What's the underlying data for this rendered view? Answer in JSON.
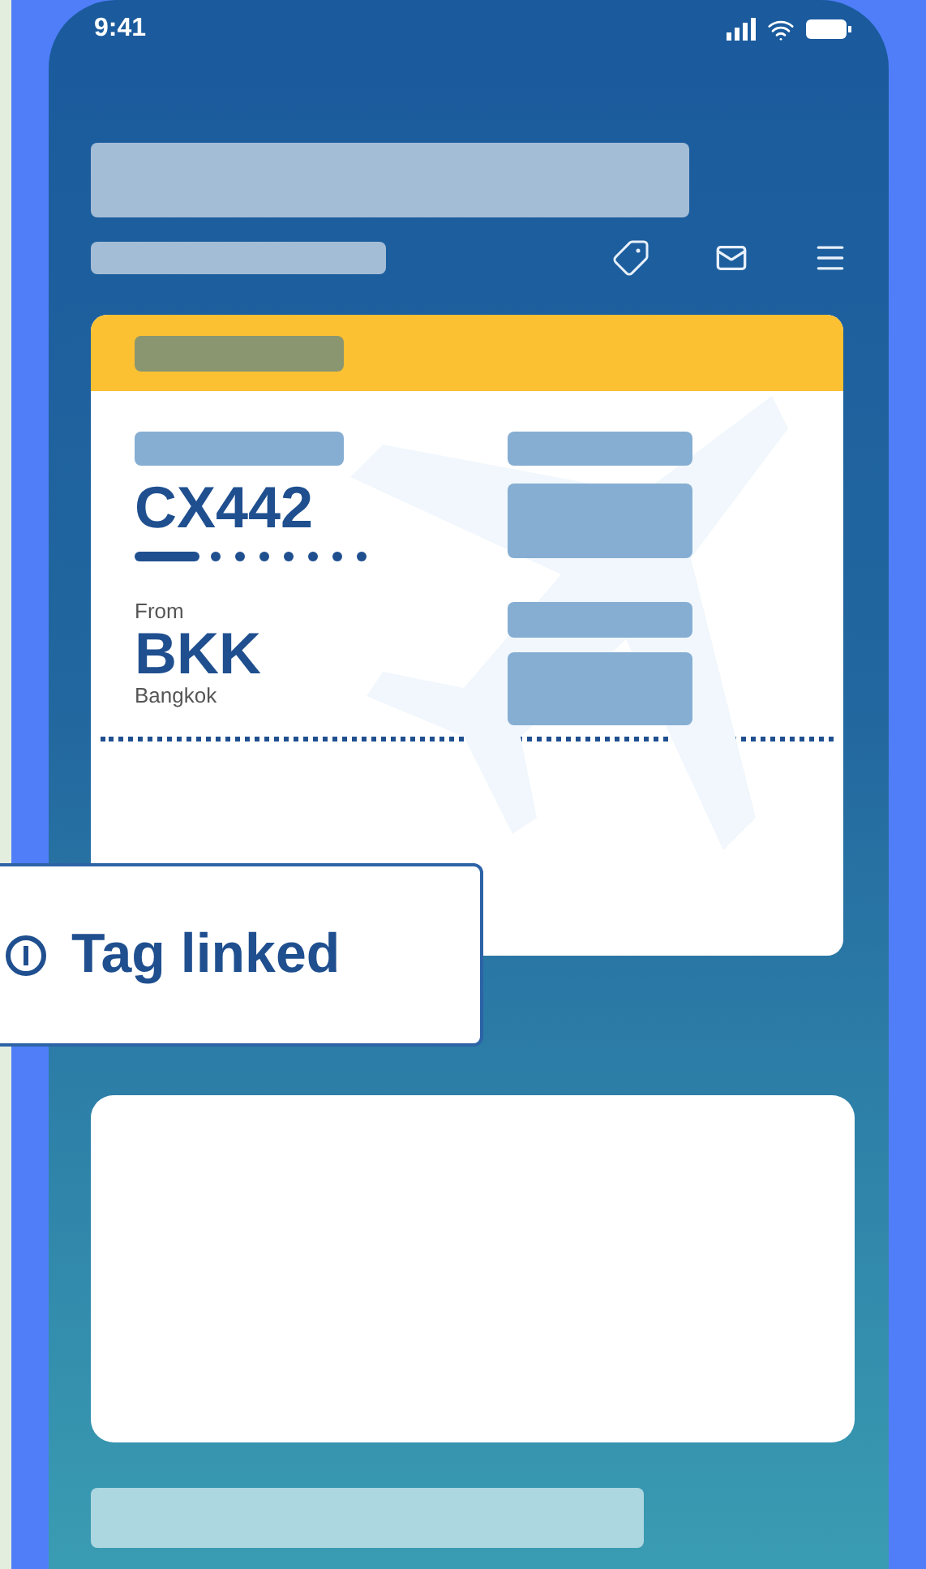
{
  "status_bar": {
    "time": "9:41"
  },
  "ticket": {
    "flight_number": "CX442",
    "from_label": "From",
    "origin_code": "BKK",
    "origin_city": "Bangkok"
  },
  "toast": {
    "text": "Tag linked"
  }
}
